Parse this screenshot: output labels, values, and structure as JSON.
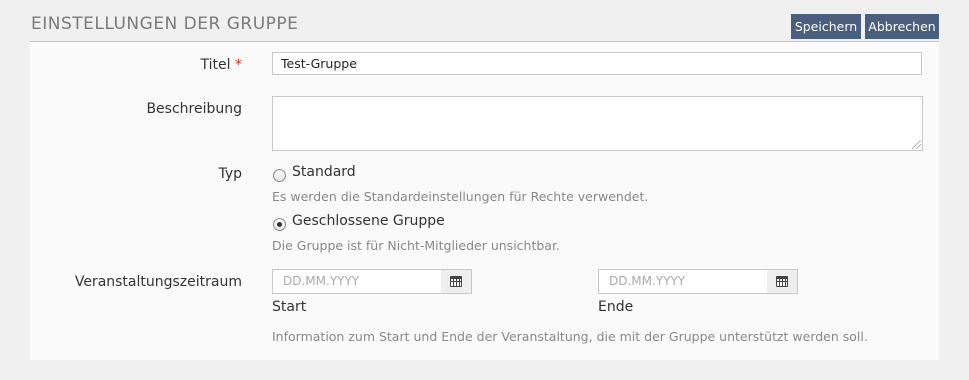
{
  "header": {
    "title": "EINSTELLUNGEN DER GRUPPE",
    "save_label": "Speichern",
    "cancel_label": "Abbrechen"
  },
  "form": {
    "title": {
      "label": "Titel",
      "required_mark": "*",
      "value": "Test-Gruppe"
    },
    "description": {
      "label": "Beschreibung",
      "value": ""
    },
    "type": {
      "label": "Typ",
      "options": [
        {
          "label": "Standard",
          "hint": "Es werden die Standardeinstellungen für Rechte verwendet.",
          "checked": false
        },
        {
          "label": "Geschlossene Gruppe",
          "hint": "Die Gruppe ist für Nicht-Mitglieder unsichtbar.",
          "checked": true
        }
      ]
    },
    "period": {
      "label": "Veranstaltungszeitraum",
      "start": {
        "placeholder": "DD.MM.YYYY",
        "label": "Start"
      },
      "end": {
        "placeholder": "DD.MM.YYYY",
        "label": "Ende"
      },
      "hint": "Information zum Start und Ende der Veranstaltung, die mit der Gruppe unterstützt werden soll."
    }
  },
  "icons": {
    "calendar": "calendar-icon"
  },
  "colors": {
    "button_bg": "#4a5f7e",
    "required": "#c9302c",
    "hint_text": "#888888",
    "page_bg": "#f0f0f0",
    "panel_bg": "#fafafa"
  }
}
